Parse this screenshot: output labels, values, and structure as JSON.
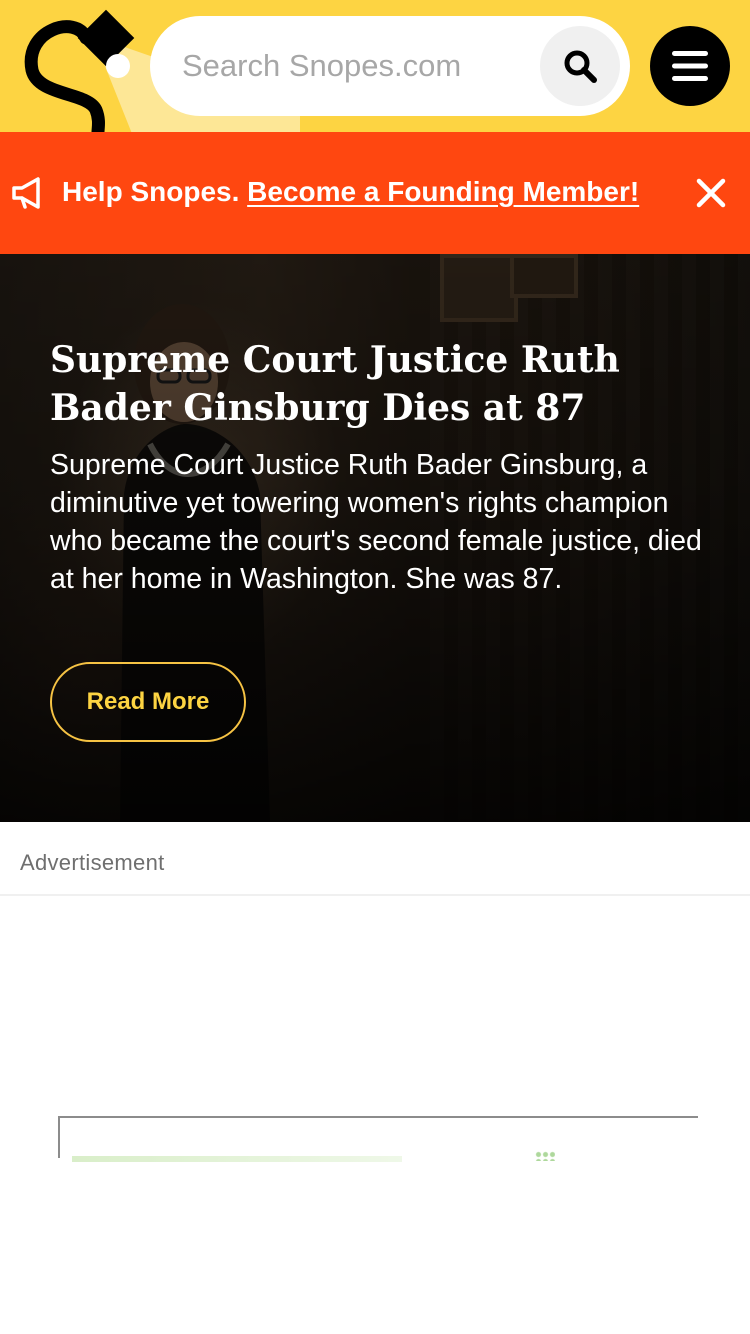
{
  "header": {
    "search": {
      "placeholder": "Search Snopes.com",
      "value": ""
    },
    "icons": {
      "logo": "snopes-logo",
      "search": "search-icon",
      "menu": "hamburger-menu-icon"
    },
    "colors": {
      "brand_yellow": "#fdd442",
      "black": "#000000"
    }
  },
  "banner": {
    "lead_text": "Help Snopes.",
    "link_text": "Become a Founding Member!",
    "icons": {
      "megaphone": "megaphone-icon",
      "close": "close-icon"
    },
    "color": "#ff4710"
  },
  "hero": {
    "title": "Supreme Court Justice Ruth Bader Ginsburg Dies at 87",
    "summary": "Supreme Court Justice Ruth Bader Ginsburg, a diminutive yet towering women's rights champion who became the court's second female justice, died at her home in Washington. She was 87.",
    "cta_label": "Read More",
    "accent_color": "#f6c344"
  },
  "ad": {
    "label": "Advertisement"
  }
}
